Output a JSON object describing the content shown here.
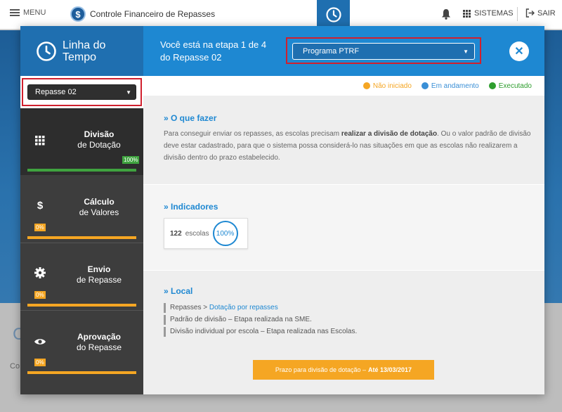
{
  "topbar": {
    "menu_label": "MENU",
    "app_title": "Controle Financeiro de Repasses",
    "systems_label": "SISTEMAS",
    "logout_label": "SAIR"
  },
  "background": {
    "heading_fragment": "C",
    "text_fragment": "Co"
  },
  "modal": {
    "title": "Linha do Tempo",
    "stage_text_line1": "Você está na etapa 1 de 4",
    "stage_text_line2": "do Repasse 02",
    "program_select": "Programa PTRF",
    "repasse_select": "Repasse 02",
    "legend": [
      {
        "label": "Não iniciado",
        "color": "#f5a623"
      },
      {
        "label": "Em andamento",
        "color": "#3a8fd6"
      },
      {
        "label": "Executado",
        "color": "#2e9e2e"
      }
    ],
    "steps": [
      {
        "line1": "Divisão",
        "line2": "de Dotação",
        "percent": "100%",
        "progress": 1.0,
        "icon": "grid-icon",
        "color": "#3fa33f"
      },
      {
        "line1": "Cálculo",
        "line2": "de Valores",
        "percent": "0%",
        "progress": 1.0,
        "icon": "dollar-icon",
        "color": "#f5a623"
      },
      {
        "line1": "Envio",
        "line2": "de Repasse",
        "percent": "0%",
        "progress": 1.0,
        "icon": "gear-icon",
        "color": "#f5a623"
      },
      {
        "line1": "Aprovação",
        "line2": "do Repasse",
        "percent": "0%",
        "progress": 1.0,
        "icon": "eye-icon",
        "color": "#f5a623"
      }
    ],
    "what_to_do": {
      "title": "» O que fazer",
      "text_a": "Para conseguir enviar os repasses, as escolas precisam ",
      "text_bold": "realizar a divisão de dotação",
      "text_b": ". Ou o valor padrão de divisão deve estar cadastrado, para que o sistema possa considerá-lo nas situações em que as escolas não realizarem a divisão dentro do prazo estabelecido."
    },
    "indicators": {
      "title": "» Indicadores",
      "count": "122",
      "unit": "escolas",
      "percent": "100%"
    },
    "local": {
      "title": "» Local",
      "path_prefix": "Repasses > ",
      "path_link": "Dotação por repasses",
      "line2": "Padrão de divisão – Etapa realizada na SME.",
      "line3": "Divisão individual por escola – Etapa realizada nas Escolas."
    },
    "deadline": {
      "text": "Prazo para divisão de dotação –",
      "date": "Até 13/03/2017"
    }
  }
}
